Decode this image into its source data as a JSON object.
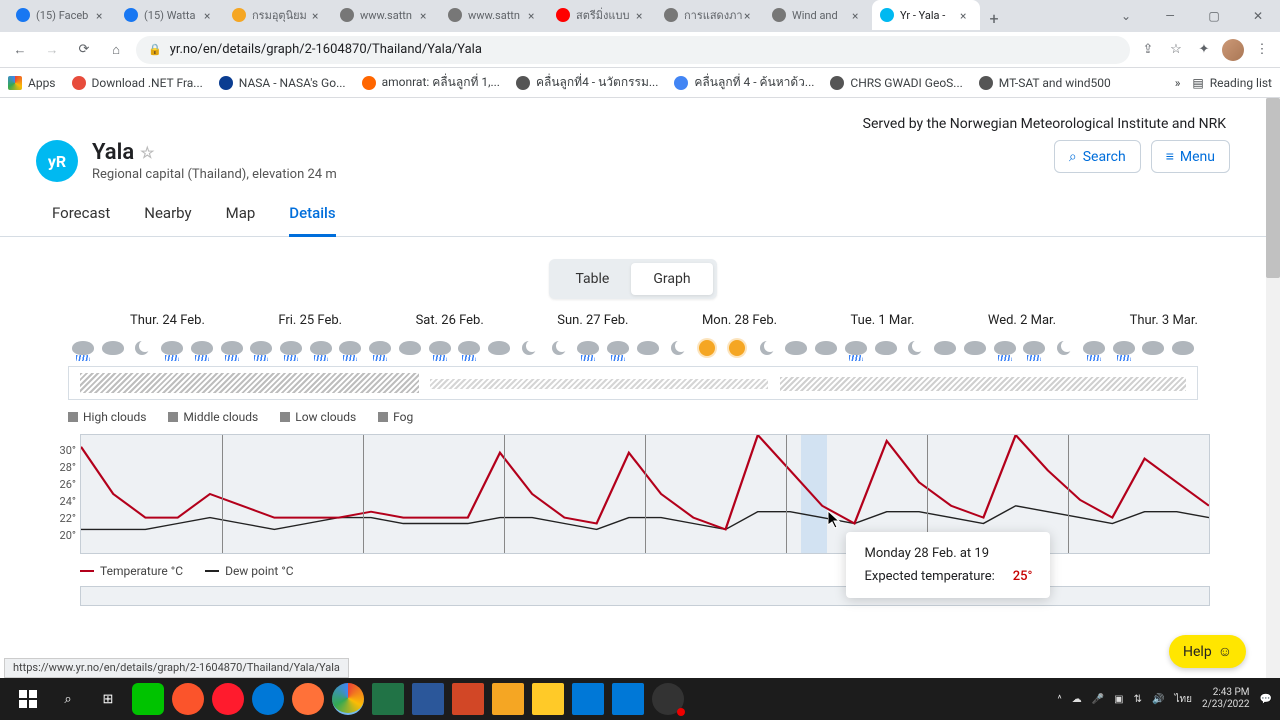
{
  "browser": {
    "tabs": [
      {
        "title": "(15) Faceb",
        "favicon": "#1877f2"
      },
      {
        "title": "(15) Watta",
        "favicon": "#1877f2"
      },
      {
        "title": "กรมอุตุนิยม",
        "favicon": "#f5a623"
      },
      {
        "title": "www.sattn",
        "favicon": "#777"
      },
      {
        "title": "www.sattn",
        "favicon": "#777"
      },
      {
        "title": "สตรีมิ่งแบบ",
        "favicon": "#ff0000"
      },
      {
        "title": "การแสดงภา",
        "favicon": "#777"
      },
      {
        "title": "Wind and",
        "favicon": "#777"
      },
      {
        "title": "Yr - Yala -",
        "favicon": "#00b9f1",
        "active": true
      }
    ],
    "url": "yr.no/en/details/graph/2-1604870/Thailand/Yala/Yala",
    "bookmarks": [
      {
        "label": "Apps",
        "fav": "#4285f4"
      },
      {
        "label": "Download .NET Fra...",
        "fav": "#e74c3c"
      },
      {
        "label": "NASA - NASA's Go...",
        "fav": "#0b3d91"
      },
      {
        "label": "amonrat: คลื่นลูกที่ 1,...",
        "fav": "#ff6600"
      },
      {
        "label": "คลื่นลูกที่4 - นวัตกรรม...",
        "fav": "#555"
      },
      {
        "label": "คลื่นลูกที่ 4 - ค้นหาด้ว...",
        "fav": "#4285f4"
      },
      {
        "label": "CHRS GWADI GeoS...",
        "fav": "#555"
      },
      {
        "label": "MT-SAT and wind500",
        "fav": "#555"
      }
    ],
    "reading_list": "Reading list"
  },
  "page": {
    "served": "Served by the Norwegian Meteorological Institute and NRK",
    "logo": "yR",
    "title": "Yala",
    "subtitle": "Regional capital (Thailand), elevation 24 m",
    "search": "Search",
    "menu": "Menu",
    "nav": [
      "Forecast",
      "Nearby",
      "Map",
      "Details"
    ],
    "nav_active": "Details",
    "toggle": {
      "table": "Table",
      "graph": "Graph"
    },
    "days": [
      "Thur. 24 Feb.",
      "Fri. 25 Feb.",
      "Sat. 26 Feb.",
      "Sun. 27 Feb.",
      "Mon. 28 Feb.",
      "Tue. 1 Mar.",
      "Wed. 2 Mar.",
      "Thur. 3 Mar."
    ],
    "cloud_legend": [
      "High clouds",
      "Middle clouds",
      "Low clouds",
      "Fog"
    ],
    "yaxis": [
      "30°",
      "28°",
      "26°",
      "24°",
      "22°",
      "20°"
    ],
    "series_legend": {
      "temp": "Temperature °C",
      "dew": "Dew point °C"
    },
    "tooltip": {
      "title": "Monday 28 Feb. at 19",
      "label": "Expected temperature:",
      "value": "25°"
    },
    "help": "Help",
    "status_url": "https://www.yr.no/en/details/graph/2-1604870/Thailand/Yala/Yala"
  },
  "chart_data": {
    "type": "line",
    "title": "Temperature / Dew point",
    "ylabel": "°C",
    "ylim": [
      20,
      30
    ],
    "x": [
      0,
      1,
      2,
      3,
      4,
      5,
      6,
      7,
      8,
      9,
      10,
      11,
      12,
      13,
      14,
      15,
      16,
      17,
      18,
      19,
      20,
      21,
      22,
      23,
      24,
      25,
      26,
      27,
      28,
      29,
      30,
      31,
      32,
      33,
      34,
      35
    ],
    "series": [
      {
        "name": "Temperature °C",
        "color": "#b3001b",
        "values": [
          29,
          25,
          23,
          23,
          25,
          24,
          23,
          23,
          23,
          23.5,
          23,
          23,
          23,
          28.5,
          25,
          23,
          22.5,
          28.5,
          25,
          23,
          22,
          30,
          27,
          24,
          22.5,
          29.5,
          26,
          24,
          23,
          30,
          27,
          24.5,
          23,
          28,
          26,
          24
        ]
      },
      {
        "name": "Dew point °C",
        "color": "#222",
        "values": [
          22,
          22,
          22,
          22.5,
          23,
          22.5,
          22,
          22.5,
          23,
          23,
          22.5,
          22.5,
          22.5,
          23,
          23,
          22.5,
          22,
          23,
          23,
          22.5,
          22,
          23.5,
          23.5,
          23,
          22.5,
          23.5,
          23.5,
          23,
          22.5,
          24,
          23.5,
          23,
          22.5,
          23.5,
          23.5,
          23
        ]
      }
    ]
  },
  "system": {
    "time": "2:43 PM",
    "date": "2/23/2022",
    "lang": "ไทย"
  }
}
